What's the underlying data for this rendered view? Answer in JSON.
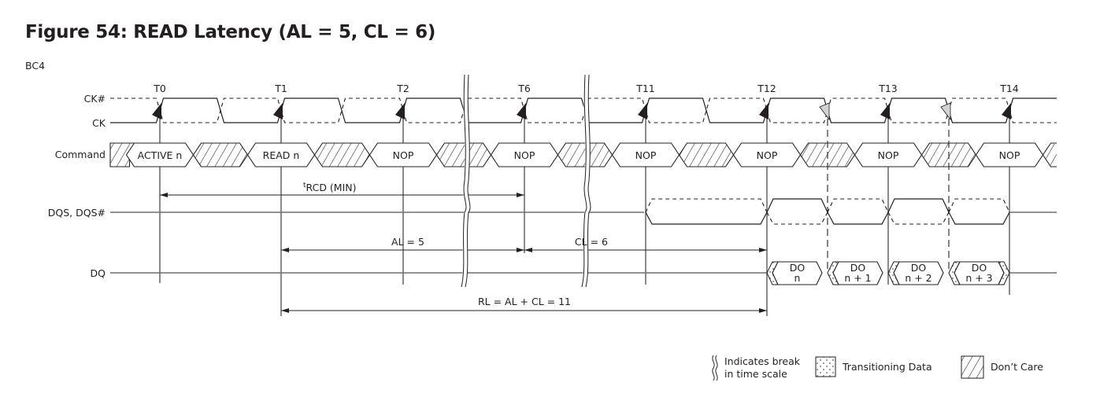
{
  "figure": {
    "title": "Figure 54: READ Latency (AL = 5, CL = 6)",
    "mode_label": "BC4"
  },
  "clock_ticks": [
    "T0",
    "T1",
    "T2",
    "T6",
    "T11",
    "T12",
    "T13",
    "T14"
  ],
  "signals": {
    "ck_n": "CK#",
    "ck": "CK",
    "command": "Command",
    "dqs": "DQS, DQS#",
    "dq": "DQ"
  },
  "commands": [
    "ACTIVE n",
    "READ n",
    "NOP",
    "NOP",
    "NOP",
    "NOP",
    "NOP",
    "NOP"
  ],
  "data_out": [
    {
      "top": "DO",
      "bottom": "n"
    },
    {
      "top": "DO",
      "bottom": "n + 1"
    },
    {
      "top": "DO",
      "bottom": "n + 2"
    },
    {
      "top": "DO",
      "bottom": "n + 3"
    }
  ],
  "timings": {
    "trcd_sup": "t",
    "trcd": "RCD (MIN)",
    "al": "AL = 5",
    "cl": "CL = 6",
    "rl": "RL = AL + CL = 11"
  },
  "legend": {
    "break_line1": "Indicates break",
    "break_line2": "in time scale",
    "transitioning": "Transitioning Data",
    "dont_care": "Don’t Care"
  }
}
